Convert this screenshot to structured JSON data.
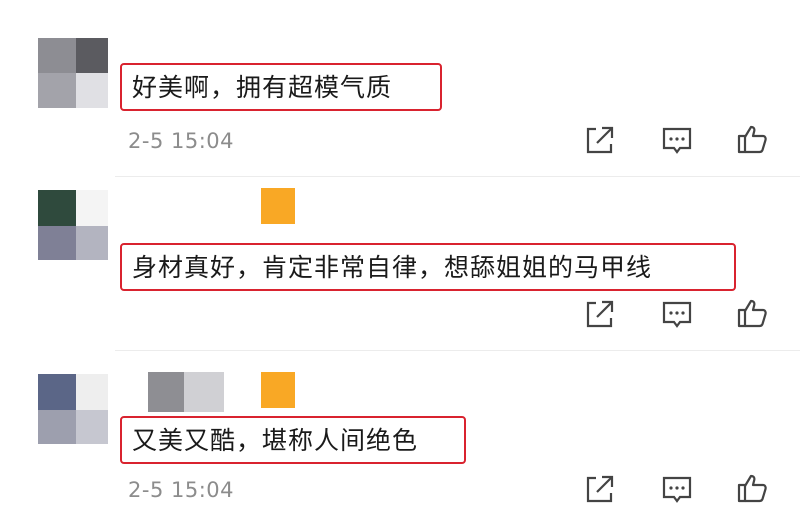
{
  "comments": [
    {
      "text": "好美啊，拥有超模气质",
      "time": "2-5 15:04"
    },
    {
      "text": "身材真好，肯定非常自律，想舔姐姐的马甲线",
      "time": ""
    },
    {
      "text": "又美又酷，堪称人间绝色",
      "time": "2-5 15:04"
    }
  ],
  "icons": {
    "share": "share-icon",
    "comment": "comment-icon",
    "like": "thumbs-up-icon"
  },
  "colors": {
    "highlight_border": "#d9232f",
    "badge": "#f9a825",
    "timestamp": "#8c8c8c"
  }
}
